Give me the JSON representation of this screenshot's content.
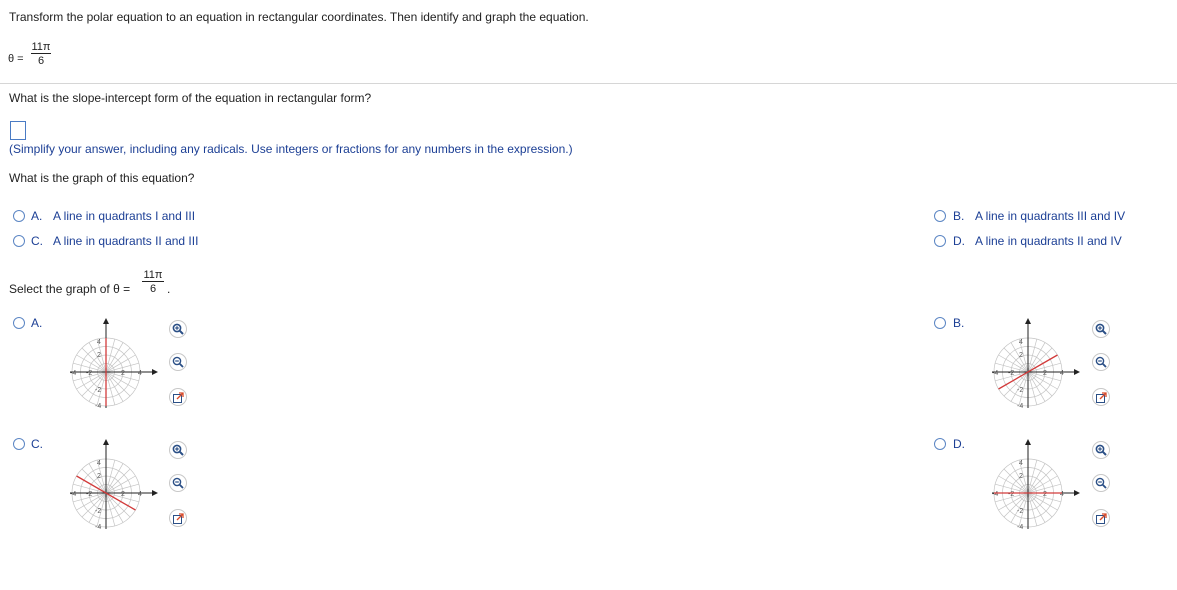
{
  "problem": {
    "instruction": "Transform the polar equation to an equation in rectangular coordinates. Then identify and graph the equation.",
    "equation_lhs": "θ =",
    "equation_num": "11π",
    "equation_den": "6"
  },
  "question1": {
    "prompt": "What is the slope-intercept form of the equation in rectangular form?",
    "answer_value": "",
    "hint": "(Simplify your answer, including any radicals.  Use integers or fractions for any numbers in the expression.)"
  },
  "question2": {
    "prompt": "What is the graph of this equation?",
    "choices": [
      {
        "letter": "A.",
        "text": "A line in quadrants I and III"
      },
      {
        "letter": "B.",
        "text": "A line in quadrants III and IV"
      },
      {
        "letter": "C.",
        "text": "A line in quadrants II and III"
      },
      {
        "letter": "D.",
        "text": "A line in quadrants II and IV"
      }
    ]
  },
  "question3": {
    "prompt": "Select the graph of θ =",
    "num": "11π",
    "den": "6",
    "period": ".",
    "graphs": [
      {
        "letter": "A.",
        "line": "vertical"
      },
      {
        "letter": "B.",
        "line": "positive-slope"
      },
      {
        "letter": "C.",
        "line": "negative-slope"
      },
      {
        "letter": "D.",
        "line": "horizontal"
      }
    ],
    "tick_labels": {
      "pos4": "4",
      "pos2": "2",
      "neg2": "-2",
      "neg4": "-4"
    },
    "line_color": "#d23a3a"
  },
  "icons": {
    "zoom_in": "zoom-in-icon",
    "zoom_out": "zoom-out-icon",
    "open_new": "open-window-icon"
  }
}
